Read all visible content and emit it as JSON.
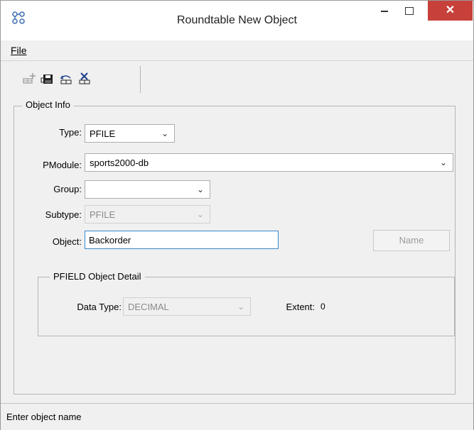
{
  "window": {
    "title": "Roundtable New Object",
    "app_icon": "roundtable-logo-icon",
    "controls": {
      "minimize": "minimize-icon",
      "maximize": "maximize-icon",
      "close": "✕"
    }
  },
  "menu": {
    "file": "File"
  },
  "toolbar": {
    "buttons": [
      {
        "icon": "add-object-icon",
        "enabled": false
      },
      {
        "icon": "save-icon",
        "enabled": true
      },
      {
        "icon": "undo-icon",
        "enabled": true
      },
      {
        "icon": "delete-icon",
        "enabled": true
      }
    ]
  },
  "object_info": {
    "legend": "Object Info",
    "type": {
      "label": "Type:",
      "value": "PFILE"
    },
    "pmodule": {
      "label": "PModule:",
      "value": "sports2000-db"
    },
    "group": {
      "label": "Group:",
      "value": ""
    },
    "subtype": {
      "label": "Subtype:",
      "value": "PFILE",
      "disabled": true
    },
    "object": {
      "label": "Object:",
      "value": "Backorder"
    },
    "name_button": "Name"
  },
  "pfield_detail": {
    "legend": "PFIELD Object Detail",
    "data_type": {
      "label": "Data Type:",
      "value": "DECIMAL",
      "disabled": true
    },
    "extent": {
      "label": "Extent:",
      "value": "0"
    }
  },
  "status": {
    "text": "Enter object name"
  },
  "colors": {
    "close_button": "#c7413a",
    "focus_border": "#3a87c8"
  }
}
